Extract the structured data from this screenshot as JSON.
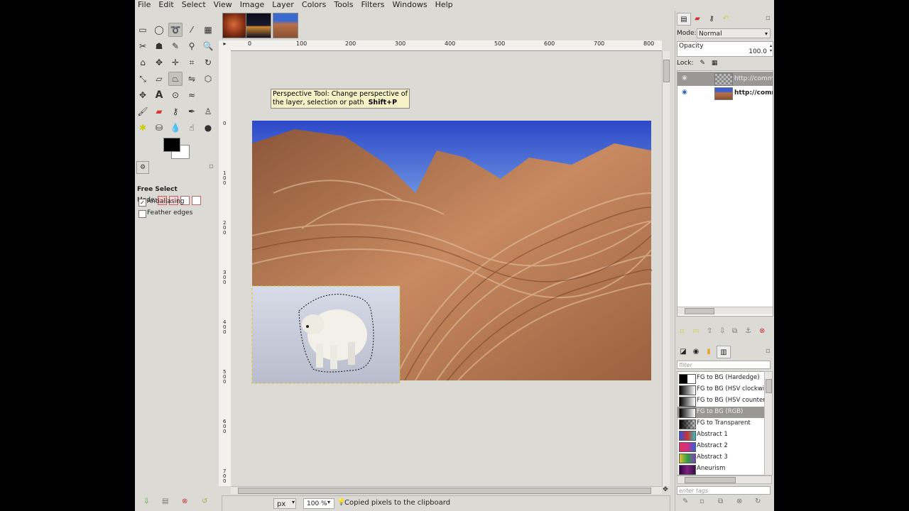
{
  "menubar": {
    "items": [
      "File",
      "Edit",
      "Select",
      "View",
      "Image",
      "Layer",
      "Colors",
      "Tools",
      "Filters",
      "Windows",
      "Help"
    ]
  },
  "tool_options": {
    "title": "Free Select",
    "mode_label": "Mode:",
    "antialiasing_label": "Antialiasing",
    "antialiasing_checked": true,
    "feather_label": "Feather edges",
    "feather_checked": false
  },
  "tooltip": {
    "line1": "Perspective Tool: Change perspective of",
    "line2": "the layer, selection or path",
    "shortcut": "Shift+P"
  },
  "rulers": {
    "h_labels": [
      "0",
      "100",
      "200",
      "300",
      "400",
      "500",
      "600",
      "700",
      "800"
    ],
    "v_labels": [
      "0",
      "1\n0\n0",
      "2\n0\n0",
      "3\n0\n0",
      "4\n0\n0",
      "5\n0\n0",
      "6\n0\n0",
      "7\n0\n0"
    ]
  },
  "statusbar": {
    "unit": "px",
    "zoom": "100 %",
    "message": "Copied pixels to the clipboard"
  },
  "layers_panel": {
    "mode_label": "Mode:",
    "mode_value": "Normal",
    "opacity_label": "Opacity",
    "opacity_value": "100.0",
    "lock_label": "Lock:",
    "layers": [
      {
        "name": "http://comm",
        "selected": true,
        "visible": true
      },
      {
        "name": "http://comm",
        "selected": false,
        "visible": true
      }
    ]
  },
  "gradients_panel": {
    "filter_placeholder": "filter",
    "tags_placeholder": "enter tags",
    "items": [
      {
        "name": "FG to BG (Hardedge)",
        "selected": false
      },
      {
        "name": "FG to BG (HSV clockwis",
        "selected": false
      },
      {
        "name": "FG to BG (HSV counter",
        "selected": false
      },
      {
        "name": "FG to BG (RGB)",
        "selected": true
      },
      {
        "name": "FG to Transparent",
        "selected": false
      },
      {
        "name": "Abstract 1",
        "selected": false
      },
      {
        "name": "Abstract 2",
        "selected": false
      },
      {
        "name": "Abstract 3",
        "selected": false
      },
      {
        "name": "Aneurism",
        "selected": false
      }
    ]
  },
  "colors": {
    "foreground": "#000000",
    "background": "#ffffff",
    "selection_marquee": "#e0c020"
  }
}
